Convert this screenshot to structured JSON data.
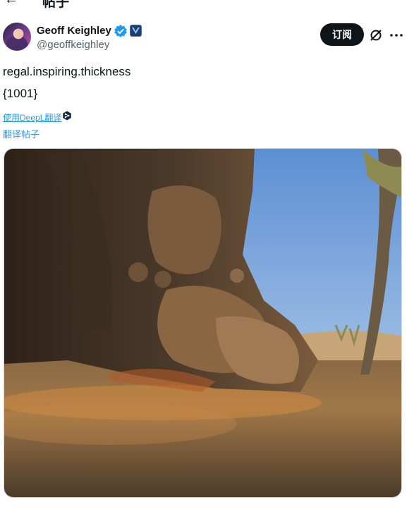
{
  "header": {
    "title": "帖子"
  },
  "author": {
    "name": "Geoff Keighley",
    "handle": "@geoffkeighley"
  },
  "actions": {
    "subscribe_label": "订阅"
  },
  "tweet": {
    "line1": "regal.inspiring.thickness",
    "line2": "{1001}"
  },
  "translation": {
    "deepl_label": "使用DeepL翻译",
    "translate_post_label": "翻译帖子"
  },
  "icons": {
    "back": "arrow-left-icon",
    "verified": "verified-badge-icon",
    "affiliate": "affiliate-logo-icon",
    "grok": "grok-icon",
    "more": "more-icon",
    "deepl": "deepl-icon"
  },
  "colors": {
    "accent": "#1d9bf0",
    "text": "#0f1419",
    "muted": "#536471",
    "button_bg": "#0f1419"
  }
}
